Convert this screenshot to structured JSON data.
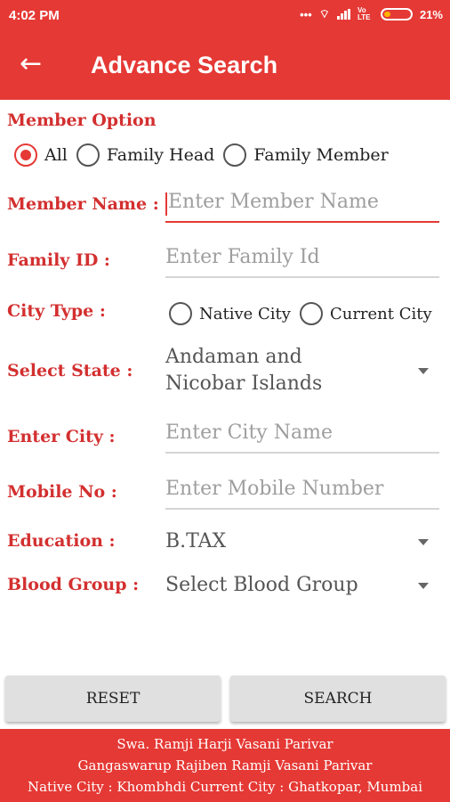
{
  "status_bar": {
    "time": "4:02 PM",
    "indicators": "•••",
    "network": "Vo LTE",
    "battery": "21%"
  },
  "app_bar": {
    "title": "Advance Search"
  },
  "member_option": {
    "label": "Member Option",
    "options": [
      "All",
      "Family Head",
      "Family Member"
    ],
    "selected": "All"
  },
  "form": {
    "member_name": {
      "label": "Member Name :",
      "placeholder": "Enter Member Name"
    },
    "family_id": {
      "label": "Family ID :",
      "placeholder": "Enter Family Id"
    },
    "city_type": {
      "label": "City Type :",
      "options": [
        "Native City",
        "Current City"
      ]
    },
    "state": {
      "label": "Select State :",
      "value_line1": "Andaman and",
      "value_line2": "Nicobar Islands"
    },
    "city": {
      "label": "Enter City :",
      "placeholder": "Enter City Name"
    },
    "mobile": {
      "label": "Mobile No :",
      "placeholder": "Enter Mobile Number"
    },
    "education": {
      "label": "Education :",
      "value": "B.TAX"
    },
    "blood_group": {
      "label": "Blood Group :",
      "value": "Select Blood Group"
    }
  },
  "buttons": {
    "reset": "RESET",
    "search": "SEARCH"
  },
  "footer": {
    "line1": "Swa. Ramji Harji Vasani Parivar",
    "line2": "Gangaswarup Rajiben Ramji Vasani Parivar",
    "line3": "Native City : Khombhdi Current City : Ghatkopar, Mumbai"
  },
  "colors": {
    "accent": "#e53935",
    "label": "#d32f2f"
  }
}
